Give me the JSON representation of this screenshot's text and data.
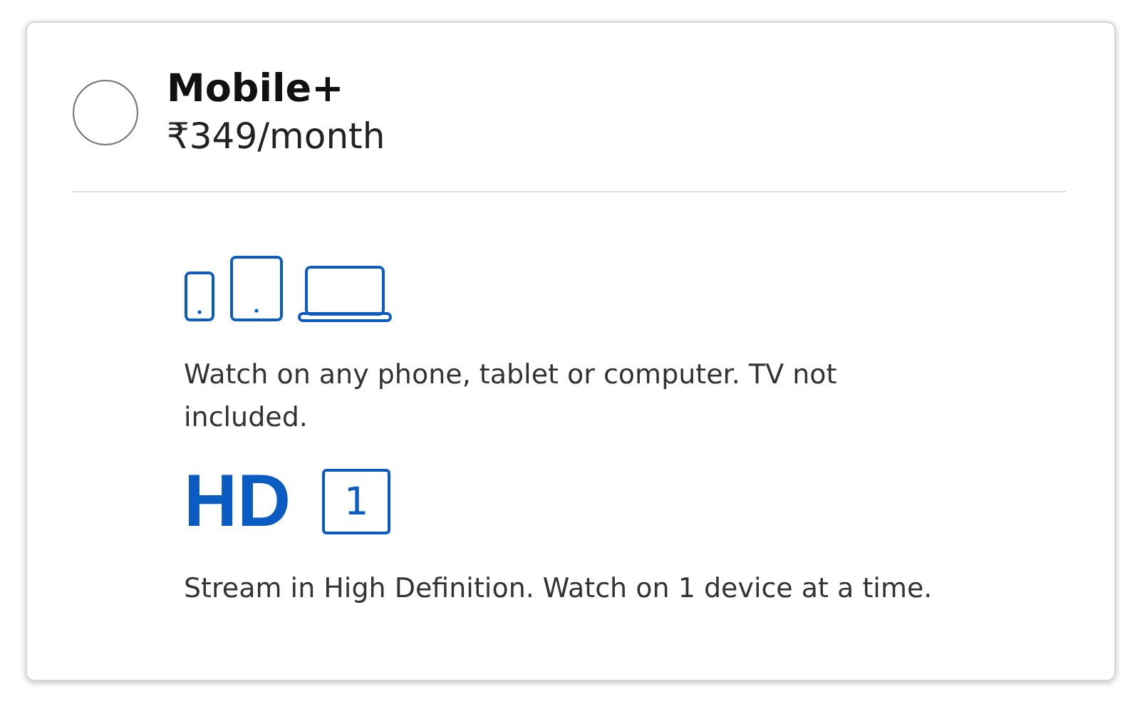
{
  "plan": {
    "name": "Mobile+",
    "price": "₹349/month",
    "selected": false
  },
  "features": [
    {
      "kind": "devices",
      "text": "Watch on any phone, tablet or computer. TV not included."
    },
    {
      "kind": "quality",
      "badge": "HD",
      "count": "1",
      "text": "Stream in High Definition. Watch on 1 device at a time."
    }
  ]
}
